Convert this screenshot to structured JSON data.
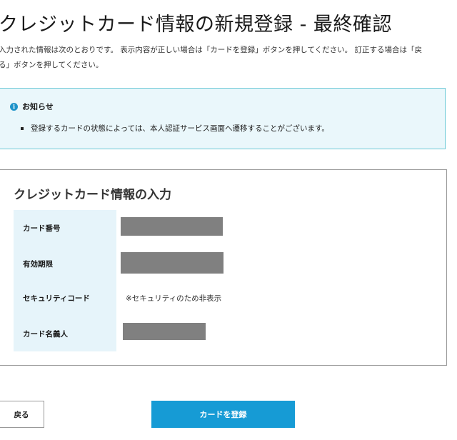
{
  "page": {
    "title": "クレジットカード情報の新規登録 - 最終確認",
    "intro_line1": "入力された情報は次のとおりです。 表示内容が正しい場合は「カードを登録」ボタンを押してください。 訂正する場合は「戻",
    "intro_line2": "る」ボタンを押してください。"
  },
  "notice": {
    "icon": "info-icon",
    "icon_glyph": "i",
    "title": "お知らせ",
    "items": [
      "登録するカードの状態によっては、本人認証サービス画面へ遷移することがございます。"
    ]
  },
  "card_info": {
    "heading": "クレジットカード情報の入力",
    "rows": [
      {
        "label": "カード番号",
        "value": null,
        "redacted": true
      },
      {
        "label": "有効期限",
        "value": null,
        "redacted": true
      },
      {
        "label": "セキュリティコード",
        "value": "※セキュリティのため非表示",
        "redacted": false
      },
      {
        "label": "カード名義人",
        "value": null,
        "redacted": true
      }
    ]
  },
  "buttons": {
    "back_label": "戻る",
    "register_label": "カードを登録"
  },
  "colors": {
    "accent": "#169bd5",
    "notice_bg": "#eaf7fb",
    "notice_border": "#6cc9d6",
    "label_bg": "#e6f4fa",
    "redaction": "#808080"
  }
}
